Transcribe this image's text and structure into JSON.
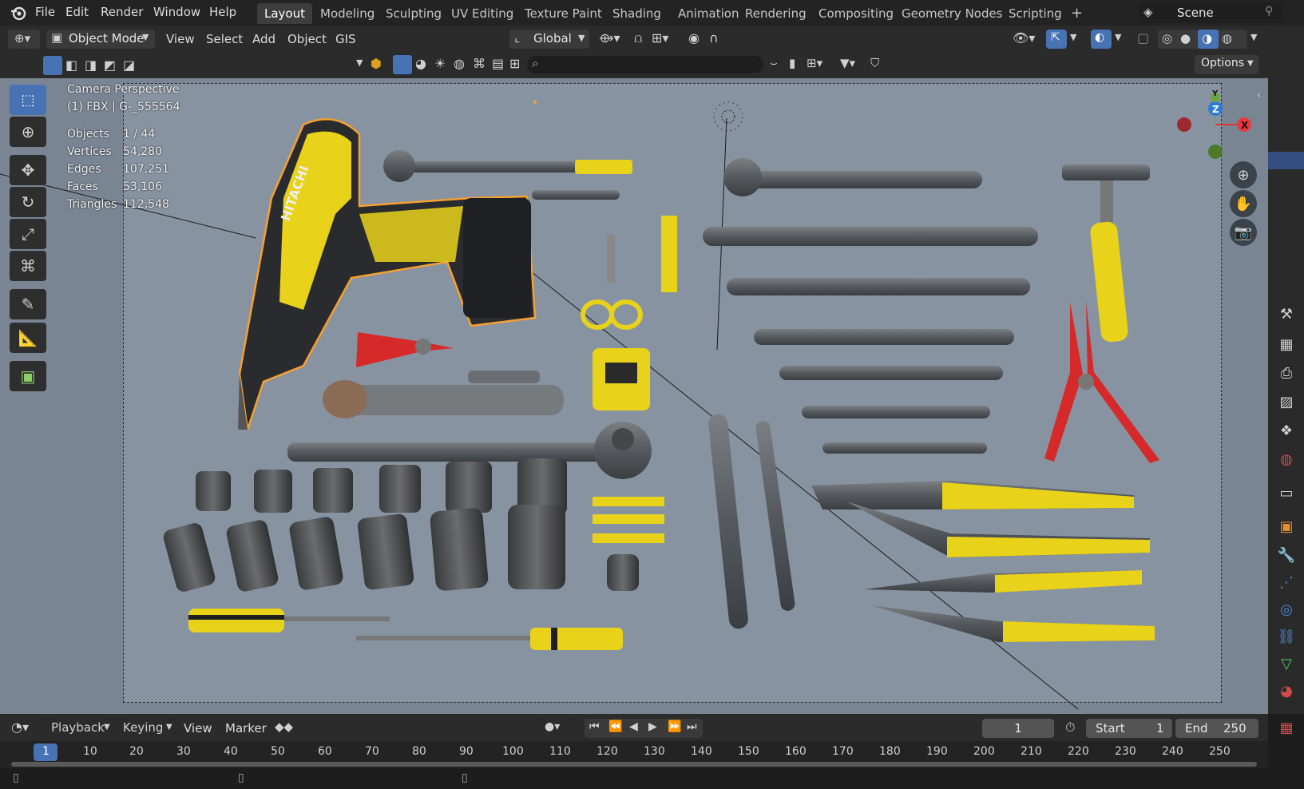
{
  "menu": {
    "file": "File",
    "edit": "Edit",
    "render": "Render",
    "window": "Window",
    "help": "Help"
  },
  "workspaces": [
    "Layout",
    "Modeling",
    "Sculpting",
    "UV Editing",
    "Texture Paint",
    "Shading",
    "Animation",
    "Rendering",
    "Compositing",
    "Geometry Nodes",
    "Scripting"
  ],
  "active_workspace": "Layout",
  "scene": "Scene",
  "header": {
    "mode": "Object Mode",
    "view": "View",
    "select": "Select",
    "add": "Add",
    "object": "Object",
    "gis": "GIS",
    "transform_orientation": "Global"
  },
  "options_label": "Options",
  "overlay_text": {
    "camera": "Camera Perspective",
    "object": "(1) FBX | G-_555564",
    "stats": [
      {
        "label": "Objects",
        "value": "1 / 44"
      },
      {
        "label": "Vertices",
        "value": "54,280"
      },
      {
        "label": "Edges",
        "value": "107,251"
      },
      {
        "label": "Faces",
        "value": "53,106"
      },
      {
        "label": "Triangles",
        "value": "112,548"
      }
    ]
  },
  "gizmo": {
    "x": "X",
    "y": "Y",
    "z": "Z"
  },
  "drill_brand": "HITACHI",
  "timeline": {
    "playback": "Playback",
    "keying": "Keying",
    "view": "View",
    "marker": "Marker",
    "current_frame": "1",
    "start_label": "Start",
    "start": "1",
    "end_label": "End",
    "end": "250",
    "ticks": [
      "1",
      "10",
      "20",
      "30",
      "40",
      "50",
      "60",
      "70",
      "80",
      "90",
      "100",
      "110",
      "120",
      "130",
      "140",
      "150",
      "160",
      "170",
      "180",
      "190",
      "200",
      "210",
      "220",
      "230",
      "240",
      "250"
    ]
  },
  "colors": {
    "accent": "#4772b3",
    "selection": "#f5a030",
    "tool_yellow": "#e8d21a",
    "plier_red": "#d62a2a"
  }
}
